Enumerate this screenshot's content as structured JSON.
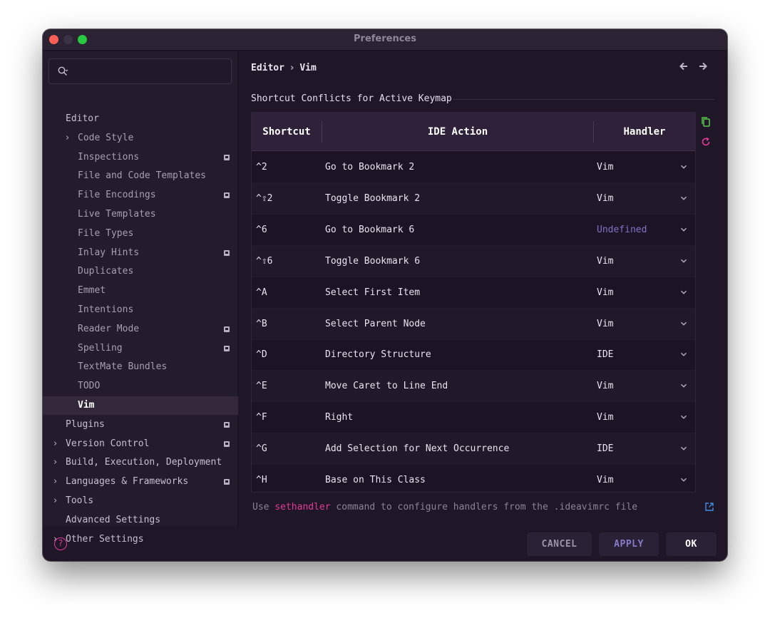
{
  "window": {
    "title": "Preferences"
  },
  "search": {
    "placeholder": ""
  },
  "sidebar": {
    "items": [
      {
        "label": "Editor",
        "level": 0,
        "chevron": false,
        "badge": false,
        "selected": false
      },
      {
        "label": "Code Style",
        "level": 1,
        "chevron": true,
        "badge": false,
        "selected": false
      },
      {
        "label": "Inspections",
        "level": 1,
        "chevron": false,
        "badge": true,
        "selected": false
      },
      {
        "label": "File and Code Templates",
        "level": 1,
        "chevron": false,
        "badge": false,
        "selected": false
      },
      {
        "label": "File Encodings",
        "level": 1,
        "chevron": false,
        "badge": true,
        "selected": false
      },
      {
        "label": "Live Templates",
        "level": 1,
        "chevron": false,
        "badge": false,
        "selected": false
      },
      {
        "label": "File Types",
        "level": 1,
        "chevron": false,
        "badge": false,
        "selected": false
      },
      {
        "label": "Inlay Hints",
        "level": 1,
        "chevron": false,
        "badge": true,
        "selected": false
      },
      {
        "label": "Duplicates",
        "level": 1,
        "chevron": false,
        "badge": false,
        "selected": false
      },
      {
        "label": "Emmet",
        "level": 1,
        "chevron": false,
        "badge": false,
        "selected": false
      },
      {
        "label": "Intentions",
        "level": 1,
        "chevron": false,
        "badge": false,
        "selected": false
      },
      {
        "label": "Reader Mode",
        "level": 1,
        "chevron": false,
        "badge": true,
        "selected": false
      },
      {
        "label": "Spelling",
        "level": 1,
        "chevron": false,
        "badge": true,
        "selected": false
      },
      {
        "label": "TextMate Bundles",
        "level": 1,
        "chevron": false,
        "badge": false,
        "selected": false
      },
      {
        "label": "TODO",
        "level": 1,
        "chevron": false,
        "badge": false,
        "selected": false
      },
      {
        "label": "Vim",
        "level": 1,
        "chevron": false,
        "badge": false,
        "selected": true
      },
      {
        "label": "Plugins",
        "level": 0,
        "chevron": false,
        "badge": true,
        "selected": false
      },
      {
        "label": "Version Control",
        "level": 0,
        "chevron": true,
        "badge": true,
        "selected": false
      },
      {
        "label": "Build, Execution, Deployment",
        "level": 0,
        "chevron": true,
        "badge": false,
        "selected": false
      },
      {
        "label": "Languages & Frameworks",
        "level": 0,
        "chevron": true,
        "badge": true,
        "selected": false
      },
      {
        "label": "Tools",
        "level": 0,
        "chevron": true,
        "badge": false,
        "selected": false
      },
      {
        "label": "Advanced Settings",
        "level": 0,
        "chevron": false,
        "badge": false,
        "selected": false
      },
      {
        "label": "Other Settings",
        "level": 0,
        "chevron": true,
        "badge": false,
        "selected": false
      }
    ]
  },
  "breadcrumb": {
    "parent": "Editor",
    "separator": "›",
    "current": "Vim"
  },
  "section": {
    "title": "Shortcut Conflicts for Active Keymap"
  },
  "table": {
    "headers": {
      "shortcut": "Shortcut",
      "action": "IDE Action",
      "handler": "Handler"
    },
    "rows": [
      {
        "shortcut": "^2",
        "action": "Go to Bookmark 2",
        "handler": "Vim"
      },
      {
        "shortcut": "^⇧2",
        "action": "Toggle Bookmark 2",
        "handler": "Vim"
      },
      {
        "shortcut": "^6",
        "action": "Go to Bookmark 6",
        "handler": "Undefined"
      },
      {
        "shortcut": "^⇧6",
        "action": "Toggle Bookmark 6",
        "handler": "Vim"
      },
      {
        "shortcut": "^A",
        "action": "Select First Item",
        "handler": "Vim"
      },
      {
        "shortcut": "^B",
        "action": "Select Parent Node",
        "handler": "Vim"
      },
      {
        "shortcut": "^D",
        "action": "Directory Structure",
        "handler": "IDE"
      },
      {
        "shortcut": "^E",
        "action": "Move Caret to Line End",
        "handler": "Vim"
      },
      {
        "shortcut": "^F",
        "action": "Right",
        "handler": "Vim"
      },
      {
        "shortcut": "^G",
        "action": "Add Selection for Next Occurrence",
        "handler": "IDE"
      },
      {
        "shortcut": "^H",
        "action": "Base on This Class",
        "handler": "Vim"
      }
    ]
  },
  "footer": {
    "note_prefix": "Use ",
    "note_command": "sethandler",
    "note_suffix": " command to configure handlers from the .ideavimrc file"
  },
  "buttons": {
    "cancel": "CANCEL",
    "apply": "APPLY",
    "ok": "OK"
  },
  "colors": {
    "accent": "#e23a9a",
    "undefined_handler": "#7f72c8",
    "copy_icon": "#59c94b"
  }
}
